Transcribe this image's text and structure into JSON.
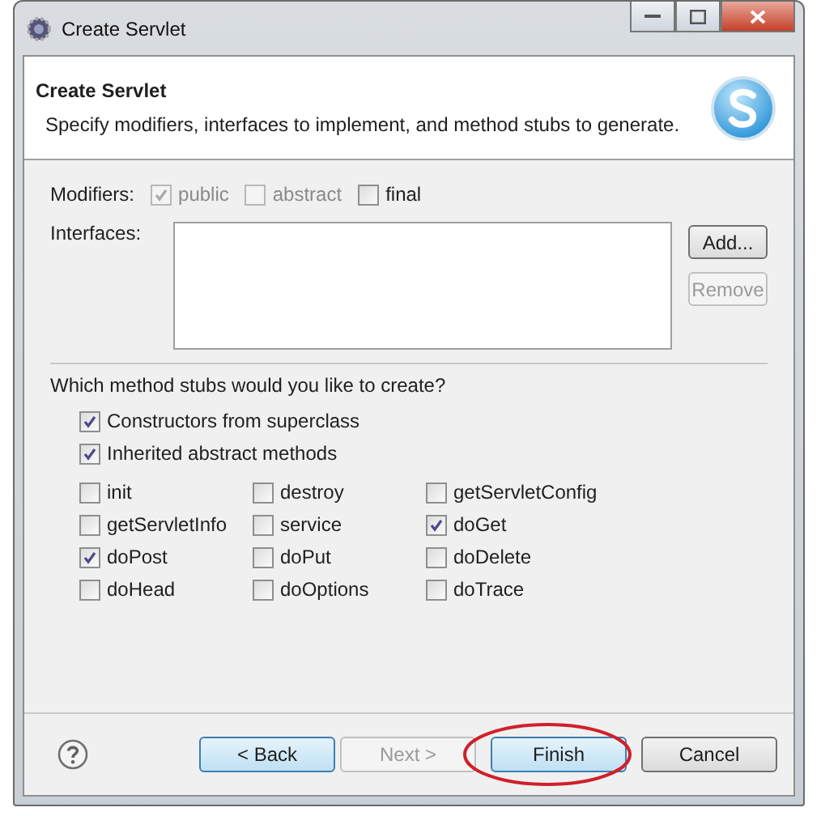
{
  "window": {
    "title": "Create Servlet"
  },
  "header": {
    "title": "Create Servlet",
    "description": "Specify modifiers, interfaces to implement, and method stubs to generate."
  },
  "modifiers": {
    "label": "Modifiers:",
    "options": [
      {
        "label": "public",
        "checked": true,
        "disabled": true
      },
      {
        "label": "abstract",
        "checked": false,
        "disabled": true
      },
      {
        "label": "final",
        "checked": false,
        "disabled": false
      }
    ]
  },
  "interfaces": {
    "label": "Interfaces:",
    "buttons": [
      {
        "label": "Add...",
        "disabled": false
      },
      {
        "label": "Remove",
        "disabled": true
      }
    ]
  },
  "stubs": {
    "question": "Which method stubs would you like to create?",
    "general": [
      {
        "label": "Constructors from superclass",
        "checked": true
      },
      {
        "label": "Inherited abstract methods",
        "checked": true
      }
    ],
    "methods": [
      {
        "label": "init",
        "checked": false
      },
      {
        "label": "destroy",
        "checked": false
      },
      {
        "label": "getServletConfig",
        "checked": false
      },
      {
        "label": "getServletInfo",
        "checked": false
      },
      {
        "label": "service",
        "checked": false
      },
      {
        "label": "doGet",
        "checked": true
      },
      {
        "label": "doPost",
        "checked": true
      },
      {
        "label": "doPut",
        "checked": false
      },
      {
        "label": "doDelete",
        "checked": false
      },
      {
        "label": "doHead",
        "checked": false
      },
      {
        "label": "doOptions",
        "checked": false
      },
      {
        "label": "doTrace",
        "checked": false
      }
    ]
  },
  "buttons": [
    {
      "label": "< Back",
      "disabled": false,
      "focused": true,
      "circled": false
    },
    {
      "label": "Next >",
      "disabled": true,
      "focused": false,
      "circled": false
    },
    {
      "label": "Finish",
      "disabled": false,
      "focused": true,
      "circled": true
    },
    {
      "label": "Cancel",
      "disabled": false,
      "focused": false,
      "circled": false
    }
  ]
}
